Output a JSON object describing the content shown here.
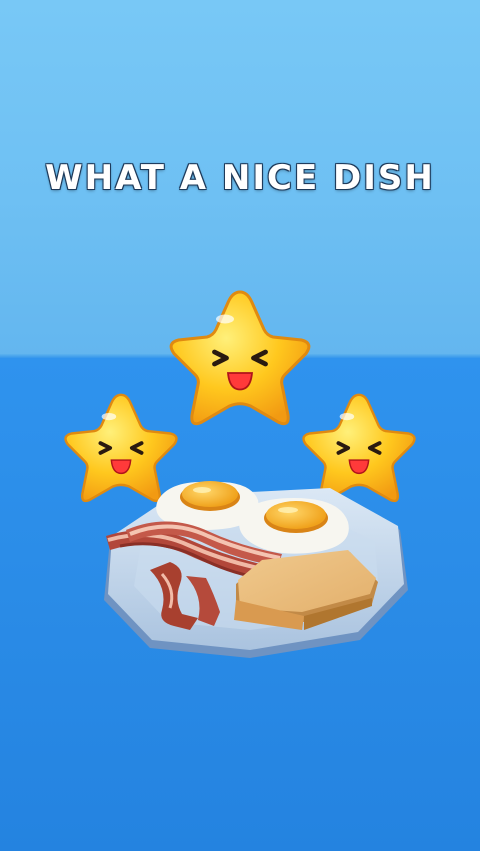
{
  "result": {
    "message": "WHAT A NICE DISH",
    "stars_earned": 3,
    "stars_total": 3,
    "star_face": "laughing",
    "dish_items": [
      "fried-egg",
      "fried-egg",
      "bacon",
      "bacon",
      "toast"
    ]
  },
  "colors": {
    "sky": "#6ec0f3",
    "floor": "#2b8de8",
    "star": "#ffc81e",
    "message_text": "#ffffff"
  }
}
